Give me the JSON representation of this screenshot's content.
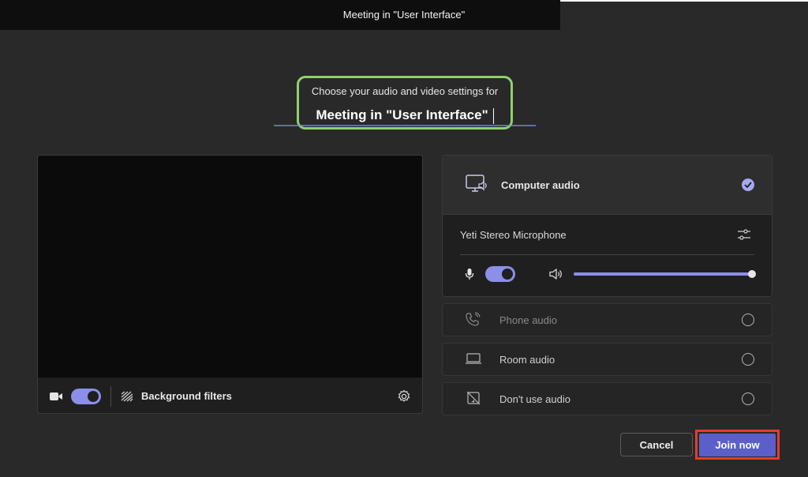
{
  "window": {
    "title": "Meeting in \"User Interface\""
  },
  "heading": {
    "subtitle": "Choose your audio and video settings for",
    "meeting_name": "Meeting in \"User Interface\""
  },
  "video": {
    "camera_on": true,
    "background_filters_label": "Background filters"
  },
  "audio": {
    "computer_audio_label": "Computer audio",
    "computer_audio_selected": true,
    "microphone_label": "Yeti Stereo Microphone",
    "mic_on": true,
    "speaker_volume": 1.0,
    "options": [
      {
        "label": "Phone audio",
        "icon": "phone-icon",
        "enabled": false
      },
      {
        "label": "Room audio",
        "icon": "room-device-icon",
        "enabled": true
      },
      {
        "label": "Don't use audio",
        "icon": "no-audio-icon",
        "enabled": true
      }
    ]
  },
  "actions": {
    "cancel_label": "Cancel",
    "join_label": "Join now"
  },
  "colors": {
    "accent": "#5b5fc7",
    "toggle_on": "#8b8fe8",
    "highlight_green": "#8fd16d",
    "highlight_red": "#e43d2b",
    "background": "#292929"
  }
}
